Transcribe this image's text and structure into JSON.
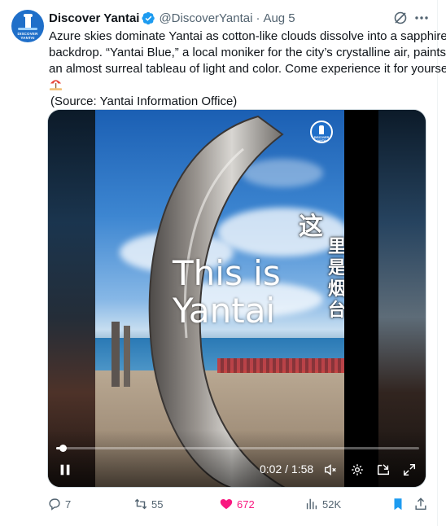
{
  "tweet": {
    "author_name": "Discover Yantai",
    "handle": "@DiscoverYantai",
    "separator": "·",
    "date": "Aug 5",
    "avatar_text": "DISCOVER YANTAI",
    "text_lines": [
      "Azure skies dominate Yantai as cotton-like clouds dissolve into a sapphire",
      "backdrop. “Yantai Blue,” a local moniker for the city’s crystalline air, paints",
      "an almost surreal tableau of light and color. Come experience it for yourself!"
    ],
    "emoji": "beach-umbrella-emoji",
    "source": "(Source: Yantai Information Office)"
  },
  "video": {
    "overlay_en_line1": "This is",
    "overlay_en_line2": "Yantai",
    "overlay_cn_big": "这",
    "overlay_cn_col": [
      "里",
      "是",
      "烟",
      "台"
    ],
    "badge_text": "DISCOVER YANTAI",
    "time": "0:02 / 1:58",
    "progress": 0.017,
    "playing": true
  },
  "actions": {
    "replies": "7",
    "reposts": "55",
    "likes": "672",
    "views": "52K"
  },
  "colors": {
    "accent": "#1d9bf0",
    "like": "#f91880",
    "muted": "#536471",
    "bookmark": "#1d9bf0"
  }
}
